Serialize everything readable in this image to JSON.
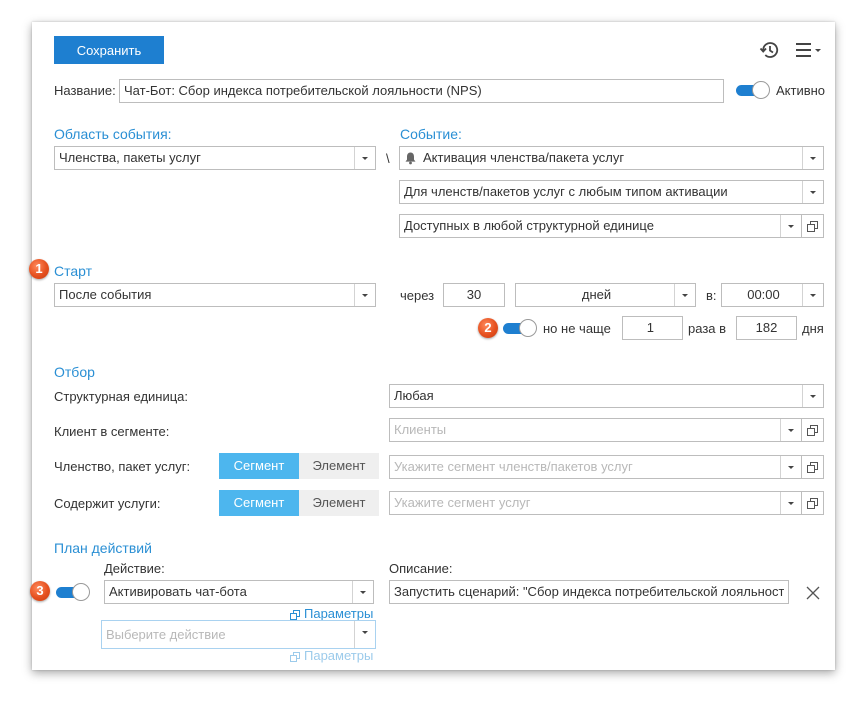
{
  "toolbar": {
    "save_label": "Сохранить",
    "history_icon": "history-icon",
    "menu_icon": "menu-icon"
  },
  "header": {
    "name_label": "Название:",
    "name_value": "Чат-Бот: Сбор индекса потребительской лояльности (NPS)",
    "active_label": "Активно",
    "active_on": true
  },
  "event": {
    "area_title": "Область события:",
    "area_value": "Членства, пакеты услуг",
    "separator": "\\",
    "event_title": "Событие:",
    "event_value": "Активация членства/пакета услуг",
    "event_icon": "bell-icon",
    "filter1_value": "Для членств/пакетов услуг с любым типом активации",
    "filter2_value": "Доступных в любой структурной единице"
  },
  "start": {
    "badge": "1",
    "title": "Старт",
    "mode_value": "После события",
    "after_label": "через",
    "after_value": "30",
    "unit_value": "дней",
    "at_label": "в:",
    "time_value": "00:00",
    "badge2": "2",
    "limit_on": true,
    "limit_label": "но не чаще",
    "limit_count": "1",
    "times_label": "раза в",
    "limit_days": "182",
    "days_label": "дня"
  },
  "selection": {
    "title": "Отбор",
    "unit_label": "Структурная единица:",
    "unit_value": "Любая",
    "client_label": "Клиент в сегменте:",
    "client_placeholder": "Клиенты",
    "membership_label": "Членство, пакет услуг:",
    "membership_placeholder": "Укажите сегмент членств/пакетов услуг",
    "services_label": "Содержит услуги:",
    "services_placeholder": "Укажите сегмент услуг",
    "segment_label": "Сегмент",
    "element_label": "Элемент"
  },
  "plan": {
    "title": "План действий",
    "badge": "3",
    "enabled": true,
    "action_label": "Действие:",
    "action_value": "Активировать чат-бота",
    "params_label": "Параметры",
    "description_label": "Описание:",
    "description_value": "Запустить сценарий: \"Сбор индекса потребительской лояльности",
    "next_action_placeholder": "Выберите действие",
    "params2_label": "Параметры"
  },
  "colors": {
    "accent": "#1e7fd0",
    "section": "#2a8fd4",
    "segment_active": "#4db6ee",
    "badge": "#e5501f"
  }
}
